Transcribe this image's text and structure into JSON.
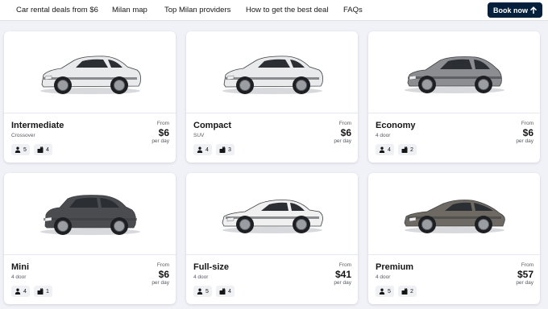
{
  "nav": {
    "links": [
      "Car rental deals from $6",
      "Milan map",
      "Top Milan providers",
      "How to get the best deal",
      "FAQs"
    ],
    "book_button": "Book now",
    "book_icon": "arrow-up-icon"
  },
  "colors": {
    "page_bg": "#f1f2f8",
    "button_bg": "#05203c",
    "chip_bg": "#eff1f5"
  },
  "cards": [
    {
      "name": "Intermediate",
      "type": "Crossover",
      "from": "From",
      "price": "$6",
      "per": "per day",
      "seats": "5",
      "bags": "4",
      "car_color": "#e9eaec"
    },
    {
      "name": "Compact",
      "type": "SUV",
      "from": "From",
      "price": "$6",
      "per": "per day",
      "seats": "4",
      "bags": "3",
      "car_color": "#e9eaec"
    },
    {
      "name": "Economy",
      "type": "4 door",
      "from": "From",
      "price": "$6",
      "per": "per day",
      "seats": "4",
      "bags": "2",
      "car_color": "#8b8d90"
    },
    {
      "name": "Mini",
      "type": "4 door",
      "from": "From",
      "price": "$6",
      "per": "per day",
      "seats": "4",
      "bags": "1",
      "car_color": "#4a4c4f"
    },
    {
      "name": "Full-size",
      "type": "4 door",
      "from": "From",
      "price": "$41",
      "per": "per day",
      "seats": "5",
      "bags": "4",
      "car_color": "#f0f0f0"
    },
    {
      "name": "Premium",
      "type": "4 door",
      "from": "From",
      "price": "$57",
      "per": "per day",
      "seats": "5",
      "bags": "2",
      "car_color": "#6e6a63"
    }
  ],
  "icons": {
    "seats": "person-icon",
    "bags": "luggage-icon"
  }
}
